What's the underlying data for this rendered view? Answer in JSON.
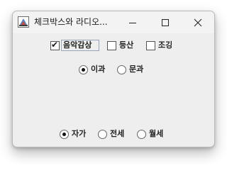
{
  "window": {
    "title": "체크박스와 라디오...",
    "controls": {
      "minimize_icon": "minimize-icon",
      "maximize_icon": "maximize-icon",
      "close_icon": "close-icon"
    }
  },
  "hobbies": [
    {
      "label": "음악감상",
      "checked": false,
      "focused": true
    },
    {
      "label": "등산",
      "checked": false
    },
    {
      "label": "조깅",
      "checked": false
    }
  ],
  "track": [
    {
      "label": "이과",
      "selected": true
    },
    {
      "label": "문과",
      "selected": false
    }
  ],
  "housing": [
    {
      "label": "자가",
      "selected": true
    },
    {
      "label": "전세",
      "selected": false
    },
    {
      "label": "월세",
      "selected": false
    }
  ],
  "colors": {
    "window_bg": "#eeeeee",
    "titlebar_bg": "#f3f3f3",
    "focus_border": "#9aa6b8"
  }
}
